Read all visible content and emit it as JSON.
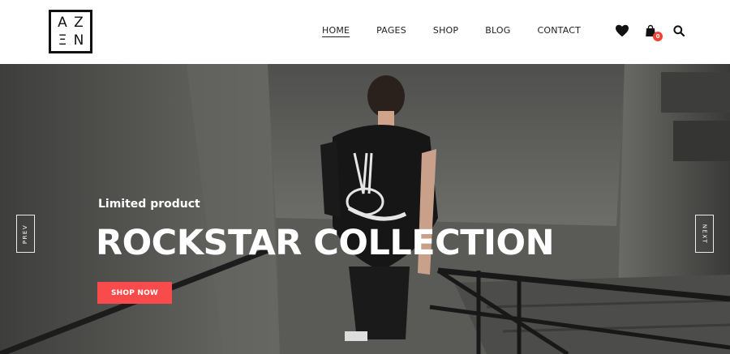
{
  "brand": {
    "logo_letters": [
      "A",
      "Z",
      "Ξ",
      "N"
    ]
  },
  "nav": {
    "items": [
      {
        "label": "HOME",
        "active": true
      },
      {
        "label": "PAGES",
        "active": false
      },
      {
        "label": "SHOP",
        "active": false
      },
      {
        "label": "BLOG",
        "active": false
      },
      {
        "label": "CONTACT",
        "active": false
      }
    ]
  },
  "header_icons": {
    "wishlist": "heart-icon",
    "cart": "shopping-bag-icon",
    "cart_count": "0",
    "search": "search-icon"
  },
  "hero": {
    "eyebrow": "Limited product",
    "title": "ROCKSTAR COLLECTION",
    "cta_label": "SHOP NOW",
    "prev_label": "PREV",
    "next_label": "NEXT"
  },
  "colors": {
    "accent": "#f94b4b",
    "text_dark": "#222222",
    "hero_overlay": "#4a4a48"
  }
}
